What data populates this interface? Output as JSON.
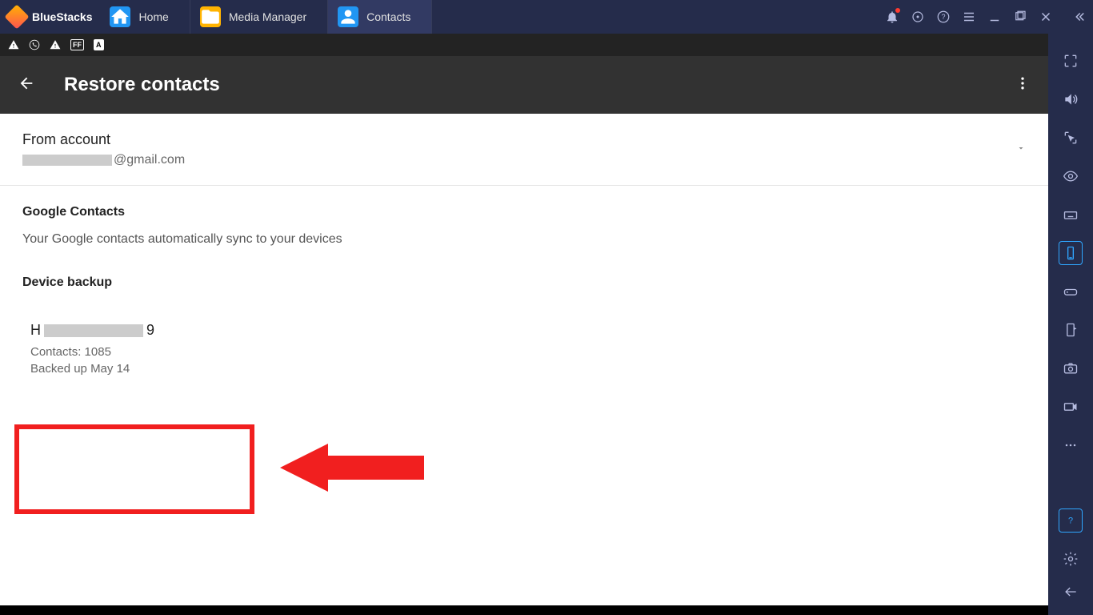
{
  "titlebar": {
    "brand": "BlueStacks",
    "tabs": [
      {
        "label": "Home",
        "icon": "home"
      },
      {
        "label": "Media Manager",
        "icon": "folder"
      },
      {
        "label": "Contacts",
        "icon": "person",
        "active": true
      }
    ]
  },
  "app": {
    "title": "Restore contacts",
    "account": {
      "label": "From account",
      "email_suffix": "@gmail.com"
    },
    "google_contacts": {
      "heading": "Google Contacts",
      "subtitle": "Your Google contacts automatically sync to your devices"
    },
    "device_backup": {
      "heading": "Device backup",
      "device_prefix": "H",
      "device_suffix": "9",
      "contacts_label": "Contacts:",
      "contacts_count": "1085",
      "backed_up_label": "Backed up",
      "backed_up_date": "May 14"
    }
  }
}
